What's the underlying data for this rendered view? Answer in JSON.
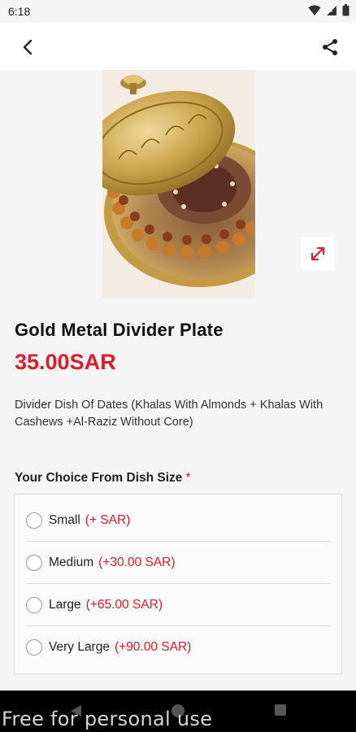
{
  "status_bar": {
    "time": "6:18",
    "icons": [
      "wifi-icon",
      "cell-signal-icon",
      "battery-icon"
    ]
  },
  "app_bar": {
    "back_icon": "chevron-left-icon",
    "share_icon": "share-icon"
  },
  "product": {
    "title": "Gold Metal Divider Plate",
    "price": "35.00SAR",
    "description": "Divider Dish Of Dates (Khalas With Almonds + Khalas With Cashews +Al-Raziz Without Core)"
  },
  "choice": {
    "title": "Your Choice From Dish Size",
    "required_mark": "*",
    "options": [
      {
        "label": "Small",
        "price": "(+ SAR)"
      },
      {
        "label": "Medium",
        "price": "(+30.00 SAR)"
      },
      {
        "label": "Large",
        "price": "(+65.00 SAR)"
      },
      {
        "label": "Very Large",
        "price": "(+90.00 SAR)"
      }
    ]
  },
  "watermark": "Free for personal use",
  "colors": {
    "accent": "#e11a2b",
    "background": "#f5f5f5"
  }
}
